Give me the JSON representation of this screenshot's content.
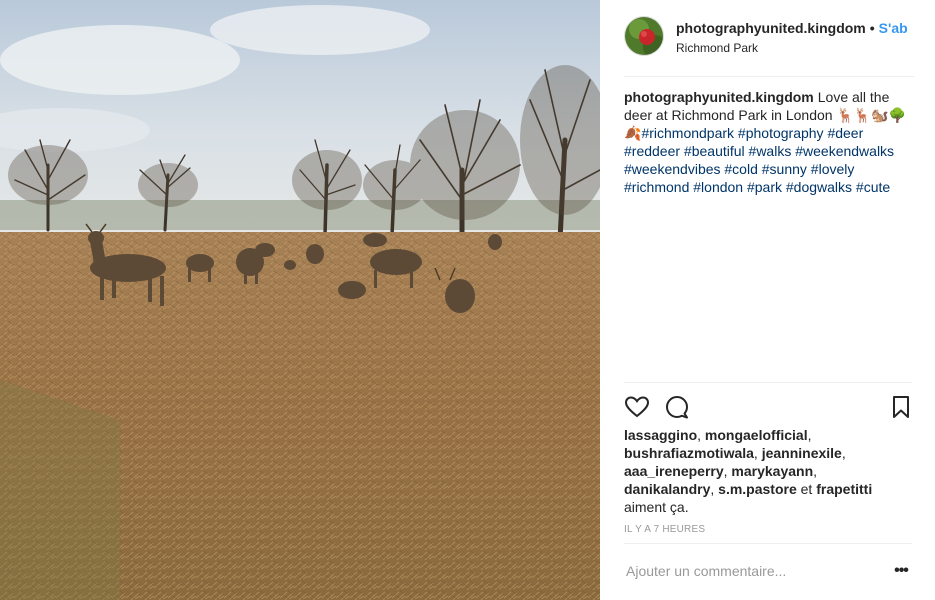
{
  "post": {
    "username": "photographyunited.kingdom",
    "separator": "•",
    "follow_label": "S'ab",
    "location": "Richmond Park",
    "caption_user": "photographyunited.kingdom",
    "caption_text": "Love all the deer at Richmond Park in London 🦌🦌🐿️🌳🍂",
    "caption_hashtags": "#richmondpark #photography #deer #reddeer #beautiful #walks #weekendwalks #weekendvibes #cold #sunny #lovely #richmond #london #park #dogwalks #cute",
    "photo_alt": "Deer at Richmond Park"
  },
  "actions": {
    "like_icon": "heart-icon",
    "comment_icon": "speech-bubble-icon",
    "save_icon": "bookmark-icon"
  },
  "likes": {
    "users": [
      "lassaggino",
      "mongaelofficial",
      "bushrafiazmotiwala",
      "jeanninexile",
      "aaa_ireneperry",
      "marykayann",
      "danikalandry",
      "s.m.pastore",
      "frapetitti"
    ],
    "conjunction": "et",
    "suffix": "aiment ça."
  },
  "timestamp": "IL Y A 7 HEURES",
  "comment_box": {
    "placeholder": "Ajouter un commentaire...",
    "more_label": "•••"
  },
  "colors": {
    "link_blue": "#3897f0",
    "hashtag_blue": "#003569",
    "border": "#efefef",
    "muted": "#999999"
  }
}
